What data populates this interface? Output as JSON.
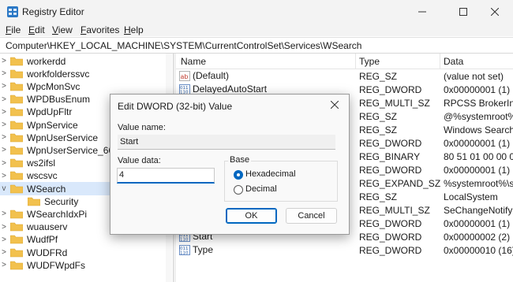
{
  "window": {
    "title": "Registry Editor"
  },
  "menu": [
    "File",
    "Edit",
    "View",
    "Favorites",
    "Help"
  ],
  "address": "Computer\\HKEY_LOCAL_MACHINE\\SYSTEM\\CurrentControlSet\\Services\\WSearch",
  "tree": [
    {
      "label": "workerdd",
      "expander": ">"
    },
    {
      "label": "workfolderssvc",
      "expander": ">"
    },
    {
      "label": "WpcMonSvc",
      "expander": ">"
    },
    {
      "label": "WPDBusEnum",
      "expander": ">"
    },
    {
      "label": "WpdUpFltr",
      "expander": ">"
    },
    {
      "label": "WpnService",
      "expander": ">"
    },
    {
      "label": "WpnUserService",
      "expander": ">"
    },
    {
      "label": "WpnUserService_66236",
      "expander": ">"
    },
    {
      "label": "ws2ifsl",
      "expander": ">"
    },
    {
      "label": "wscsvc",
      "expander": ">"
    },
    {
      "label": "WSearch",
      "expander": "v",
      "selected": true
    },
    {
      "label": "Security",
      "expander": "",
      "child": true
    },
    {
      "label": "WSearchIdxPi",
      "expander": ">"
    },
    {
      "label": "wuauserv",
      "expander": ">"
    },
    {
      "label": "WudfPf",
      "expander": ">"
    },
    {
      "label": "WUDFRd",
      "expander": ">"
    },
    {
      "label": "WUDFWpdFs",
      "expander": ">"
    }
  ],
  "list": {
    "columns": {
      "name": "Name",
      "type": "Type",
      "data": "Data"
    },
    "rows": [
      {
        "name": "(Default)",
        "type": "REG_SZ",
        "data": "(value not set)",
        "icon": "string-value-icon"
      },
      {
        "name": "DelayedAutoStart",
        "type": "REG_DWORD",
        "data": "0x00000001 (1)",
        "icon": "binary-value-icon"
      },
      {
        "name": "",
        "type": "REG_MULTI_SZ",
        "data": "RPCSS BrokerInfra",
        "icon": "string-value-icon"
      },
      {
        "name": "",
        "type": "REG_SZ",
        "data": "@%systemroot%\\",
        "icon": "string-value-icon"
      },
      {
        "name": "",
        "type": "REG_SZ",
        "data": "Windows Search",
        "icon": "string-value-icon"
      },
      {
        "name": "",
        "type": "REG_DWORD",
        "data": "0x00000001 (1)",
        "icon": "binary-value-icon"
      },
      {
        "name": "",
        "type": "REG_BINARY",
        "data": "80 51 01 00 00 00 0",
        "icon": "binary-value-icon"
      },
      {
        "name": "",
        "type": "REG_DWORD",
        "data": "0x00000001 (1)",
        "icon": "binary-value-icon"
      },
      {
        "name": "",
        "type": "REG_EXPAND_SZ",
        "data": "%systemroot%\\sy",
        "icon": "string-value-icon"
      },
      {
        "name": "",
        "type": "REG_SZ",
        "data": "LocalSystem",
        "icon": "string-value-icon"
      },
      {
        "name": "",
        "type": "REG_MULTI_SZ",
        "data": "SeChangeNotifyPr",
        "icon": "string-value-icon"
      },
      {
        "name": "",
        "type": "REG_DWORD",
        "data": "0x00000001 (1)",
        "icon": "binary-value-icon"
      },
      {
        "name": "Start",
        "type": "REG_DWORD",
        "data": "0x00000002 (2)",
        "icon": "binary-value-icon"
      },
      {
        "name": "Type",
        "type": "REG_DWORD",
        "data": "0x00000010 (16)",
        "icon": "binary-value-icon"
      }
    ]
  },
  "dialog": {
    "title": "Edit DWORD (32-bit) Value",
    "value_name_label": "Value name:",
    "value_name": "Start",
    "value_data_label": "Value data:",
    "value_data": "4",
    "base_label": "Base",
    "hex_label": "Hexadecimal",
    "dec_label": "Decimal",
    "hex_selected": true,
    "ok_label": "OK",
    "cancel_label": "Cancel"
  },
  "colors": {
    "accent": "#0067c0",
    "folder": "#f2c14e",
    "selection": "#d9e8fb"
  }
}
